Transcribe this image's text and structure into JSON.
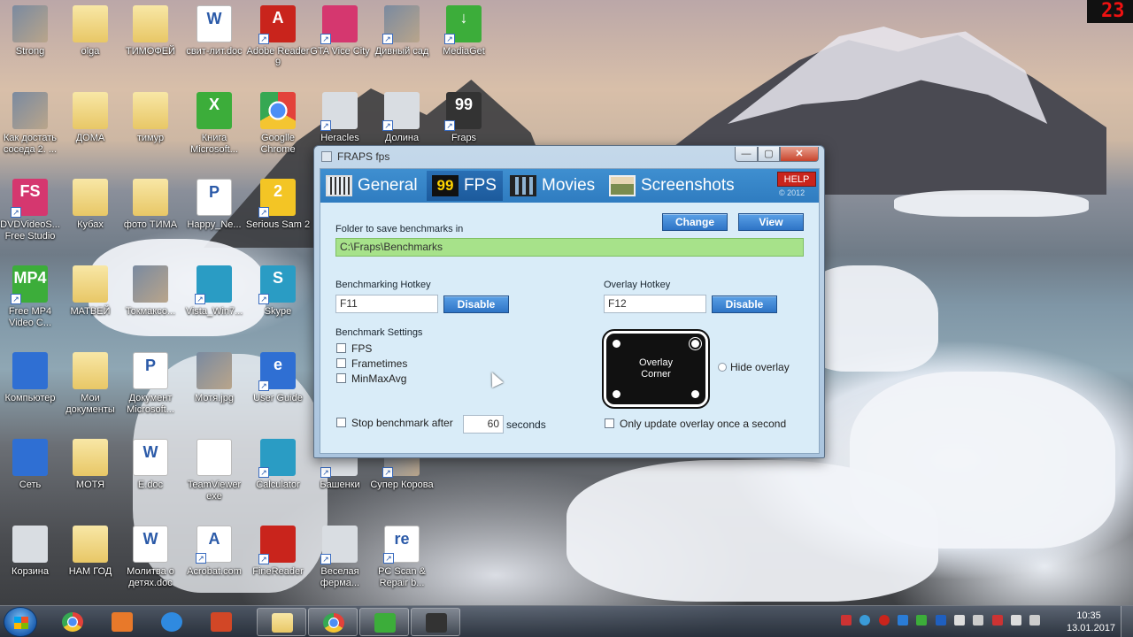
{
  "desktop": {
    "icons": [
      {
        "label": "Strong",
        "kind": "app-img",
        "sym": "",
        "shortcut": false
      },
      {
        "label": "olga",
        "kind": "folder",
        "sym": "",
        "shortcut": false
      },
      {
        "label": "ТИМОФЕЙ",
        "kind": "folder",
        "sym": "",
        "shortcut": false
      },
      {
        "label": "свит-лит.doc",
        "kind": "doc",
        "sym": "W",
        "shortcut": false
      },
      {
        "label": "Adobe Reader 9",
        "kind": "app-red",
        "sym": "A",
        "shortcut": true
      },
      {
        "label": "GTA Vice City",
        "kind": "app-pink",
        "sym": "",
        "shortcut": true
      },
      {
        "label": "Дивный сад",
        "kind": "app-img",
        "sym": "",
        "shortcut": true
      },
      {
        "label": "MediaGet",
        "kind": "app-green",
        "sym": "↓",
        "shortcut": true
      },
      {
        "label": "Как достать соседа 2. ...",
        "kind": "app-img",
        "sym": "",
        "shortcut": false
      },
      {
        "label": "ДОМА",
        "kind": "folder",
        "sym": "",
        "shortcut": false
      },
      {
        "label": "тимур",
        "kind": "folder",
        "sym": "",
        "shortcut": false
      },
      {
        "label": "Книга Microsoft...",
        "kind": "app-green",
        "sym": "X",
        "shortcut": false
      },
      {
        "label": "Googlle Chrome",
        "kind": "app-chrome",
        "sym": "",
        "shortcut": false
      },
      {
        "label": "Heracles",
        "kind": "app-gray",
        "sym": "",
        "shortcut": true
      },
      {
        "label": "Долина",
        "kind": "app-gray",
        "sym": "",
        "shortcut": true
      },
      {
        "label": "Fraps",
        "kind": "app-dark",
        "sym": "99",
        "shortcut": true
      },
      {
        "label": "DVDVideoS... Free Studio",
        "kind": "app-pink",
        "sym": "FS",
        "shortcut": true
      },
      {
        "label": "Кубах",
        "kind": "folder",
        "sym": "",
        "shortcut": false
      },
      {
        "label": "фото ТИМА",
        "kind": "folder",
        "sym": "",
        "shortcut": false
      },
      {
        "label": "Happy_Ne...",
        "kind": "doc",
        "sym": "P",
        "shortcut": false
      },
      {
        "label": "Serious Sam 2",
        "kind": "app-yellow",
        "sym": "2",
        "shortcut": true
      },
      {
        "label": "Free MP4 Video C...",
        "kind": "app-green",
        "sym": "MP4",
        "shortcut": true
      },
      {
        "label": "МАТВЕЙ",
        "kind": "folder",
        "sym": "",
        "shortcut": false
      },
      {
        "label": "Токмаксо...",
        "kind": "app-img",
        "sym": "",
        "shortcut": false
      },
      {
        "label": "Vista_Win7...",
        "kind": "app-teal",
        "sym": "",
        "shortcut": true
      },
      {
        "label": "Skype",
        "kind": "app-teal",
        "sym": "S",
        "shortcut": true
      },
      {
        "label": "Компьютер",
        "kind": "app-blue",
        "sym": "",
        "shortcut": false
      },
      {
        "label": "Мои документы",
        "kind": "folder",
        "sym": "",
        "shortcut": false
      },
      {
        "label": "Документ Microsoft...",
        "kind": "doc",
        "sym": "P",
        "shortcut": false
      },
      {
        "label": "Мотя.jpg",
        "kind": "app-img",
        "sym": "",
        "shortcut": false
      },
      {
        "label": "User Guide",
        "kind": "app-blue",
        "sym": "e",
        "shortcut": true
      },
      {
        "label": "Сеть",
        "kind": "app-blue",
        "sym": "",
        "shortcut": false
      },
      {
        "label": "МОТЯ",
        "kind": "folder",
        "sym": "",
        "shortcut": false
      },
      {
        "label": "E.doc",
        "kind": "doc",
        "sym": "W",
        "shortcut": false
      },
      {
        "label": "TeamViewer exe",
        "kind": "doc",
        "sym": "",
        "shortcut": false
      },
      {
        "label": "Calculator",
        "kind": "app-teal",
        "sym": "",
        "shortcut": true
      },
      {
        "label": "Башенки",
        "kind": "app-gray",
        "sym": "",
        "shortcut": true
      },
      {
        "label": "Супер Корова",
        "kind": "app-img",
        "sym": "",
        "shortcut": true
      },
      {
        "label": "Корзина",
        "kind": "app-gray",
        "sym": "",
        "shortcut": false
      },
      {
        "label": "НАМ ГОД",
        "kind": "folder",
        "sym": "",
        "shortcut": false
      },
      {
        "label": "Молитва о детях.doc",
        "kind": "doc",
        "sym": "W",
        "shortcut": false
      },
      {
        "label": "Acrobat.com",
        "kind": "doc",
        "sym": "A",
        "shortcut": true
      },
      {
        "label": "FineReader",
        "kind": "app-red",
        "sym": "",
        "shortcut": true
      },
      {
        "label": "Веселая ферма...",
        "kind": "app-gray",
        "sym": "",
        "shortcut": true
      },
      {
        "label": "PC Scan & Repair b...",
        "kind": "doc",
        "sym": "re",
        "shortcut": true
      }
    ]
  },
  "fraps": {
    "title": "FRAPS fps",
    "controls": {
      "minimize": "—",
      "maximize": "▢",
      "close": "✕"
    },
    "tabs": [
      {
        "label": "General",
        "icon": "grid-icon"
      },
      {
        "label": "FPS",
        "icon": "99-icon",
        "icon_text": "99"
      },
      {
        "label": "Movies",
        "icon": "film-icon"
      },
      {
        "label": "Screenshots",
        "icon": "photo-icon"
      }
    ],
    "active_tab": "FPS",
    "help_label": "HELP",
    "copyright": "© 2012",
    "folder_label": "Folder to save benchmarks in",
    "change_label": "Change",
    "view_label": "View",
    "folder_path": "C:\\Fraps\\Benchmarks",
    "benchmark_hotkey_label": "Benchmarking Hotkey",
    "benchmark_hotkey_value": "F11",
    "benchmark_disable_label": "Disable",
    "overlay_hotkey_label": "Overlay Hotkey",
    "overlay_hotkey_value": "F12",
    "overlay_disable_label": "Disable",
    "benchmark_settings_label": "Benchmark Settings",
    "fps_check_label": "FPS",
    "frametimes_check_label": "Frametimes",
    "minmaxavg_check_label": "MinMaxAvg",
    "overlay_corner_line1": "Overlay",
    "overlay_corner_line2": "Corner",
    "hide_overlay_label": "Hide overlay",
    "stop_benchmark_label": "Stop benchmark after",
    "stop_benchmark_value": "60",
    "seconds_label": "seconds",
    "only_update_label": "Only update overlay once a second"
  },
  "taskbar": {
    "time": "10:35",
    "date": "13.01.2017"
  },
  "fraps_counter": "23",
  "colors": {
    "accent": "#2e74c6",
    "path_bg": "#a7e28a",
    "help": "#c9241c",
    "counter": "#e11111"
  }
}
